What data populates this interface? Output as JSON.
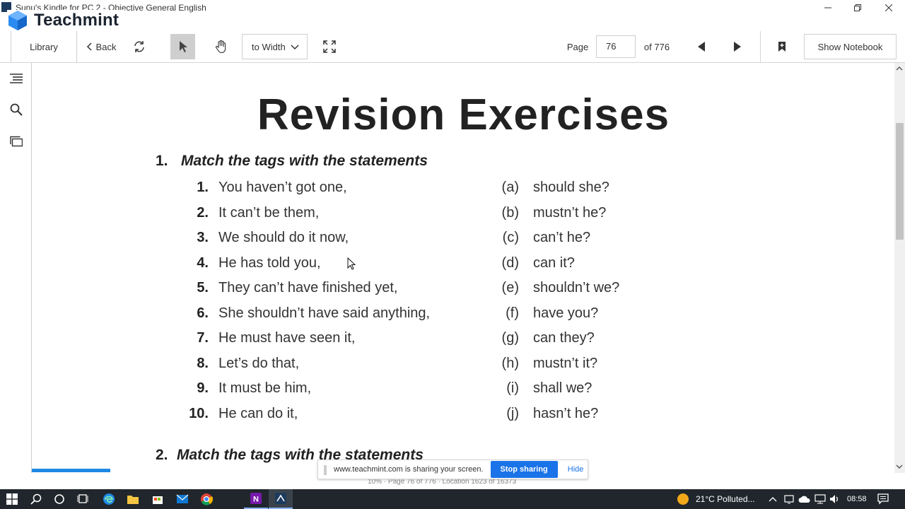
{
  "window": {
    "title": "Sunu's Kindle for PC 2 - Objective General English"
  },
  "brand": {
    "name": "Teachmint"
  },
  "toolbar": {
    "library": "Library",
    "back": "Back",
    "zoom_mode": "to Width",
    "page_label": "Page",
    "page_value": "76",
    "page_total": "of 776",
    "show_notebook": "Show Notebook"
  },
  "document": {
    "title": "Revision Exercises",
    "section1": {
      "num": "1.",
      "heading": "Match the tags with the statements"
    },
    "statements": [
      {
        "n": "1.",
        "text": "You haven’t got one,"
      },
      {
        "n": "2.",
        "text": "It can’t be them,"
      },
      {
        "n": "3.",
        "text": "We should do it now,"
      },
      {
        "n": "4.",
        "text": "He has told you,"
      },
      {
        "n": "5.",
        "text": "They can’t have finished yet,"
      },
      {
        "n": "6.",
        "text": "She shouldn’t have said anything,"
      },
      {
        "n": "7.",
        "text": "He must have seen it,"
      },
      {
        "n": "8.",
        "text": "Let’s do that,"
      },
      {
        "n": "9.",
        "text": "It must be him,"
      },
      {
        "n": "10.",
        "text": "He can do it,"
      }
    ],
    "tags": [
      {
        "l": "(a)",
        "text": "should she?"
      },
      {
        "l": "(b)",
        "text": "mustn’t he?"
      },
      {
        "l": "(c)",
        "text": "can’t he?"
      },
      {
        "l": "(d)",
        "text": "can it?"
      },
      {
        "l": "(e)",
        "text": "shouldn’t we?"
      },
      {
        "l": "(f)",
        "text": "have you?"
      },
      {
        "l": "(g)",
        "text": "can they?"
      },
      {
        "l": "(h)",
        "text": "mustn’t it?"
      },
      {
        "l": "(i)",
        "text": "shall we?"
      },
      {
        "l": "(j)",
        "text": "hasn’t he?"
      }
    ],
    "section2": {
      "num": "2.",
      "heading": "Match the tags with the statements"
    }
  },
  "share_bar": {
    "message": "www.teachmint.com is sharing your screen.",
    "stop": "Stop sharing",
    "hide": "Hide"
  },
  "status_line": "10% · Page 76 of 776 · Location 1623 of 16373",
  "taskbar": {
    "weather": "21°C  Polluted...",
    "time": "08:58"
  },
  "colors": {
    "accent": "#1a73e8",
    "progress": "#1e88e5",
    "taskbar": "#20262c"
  }
}
